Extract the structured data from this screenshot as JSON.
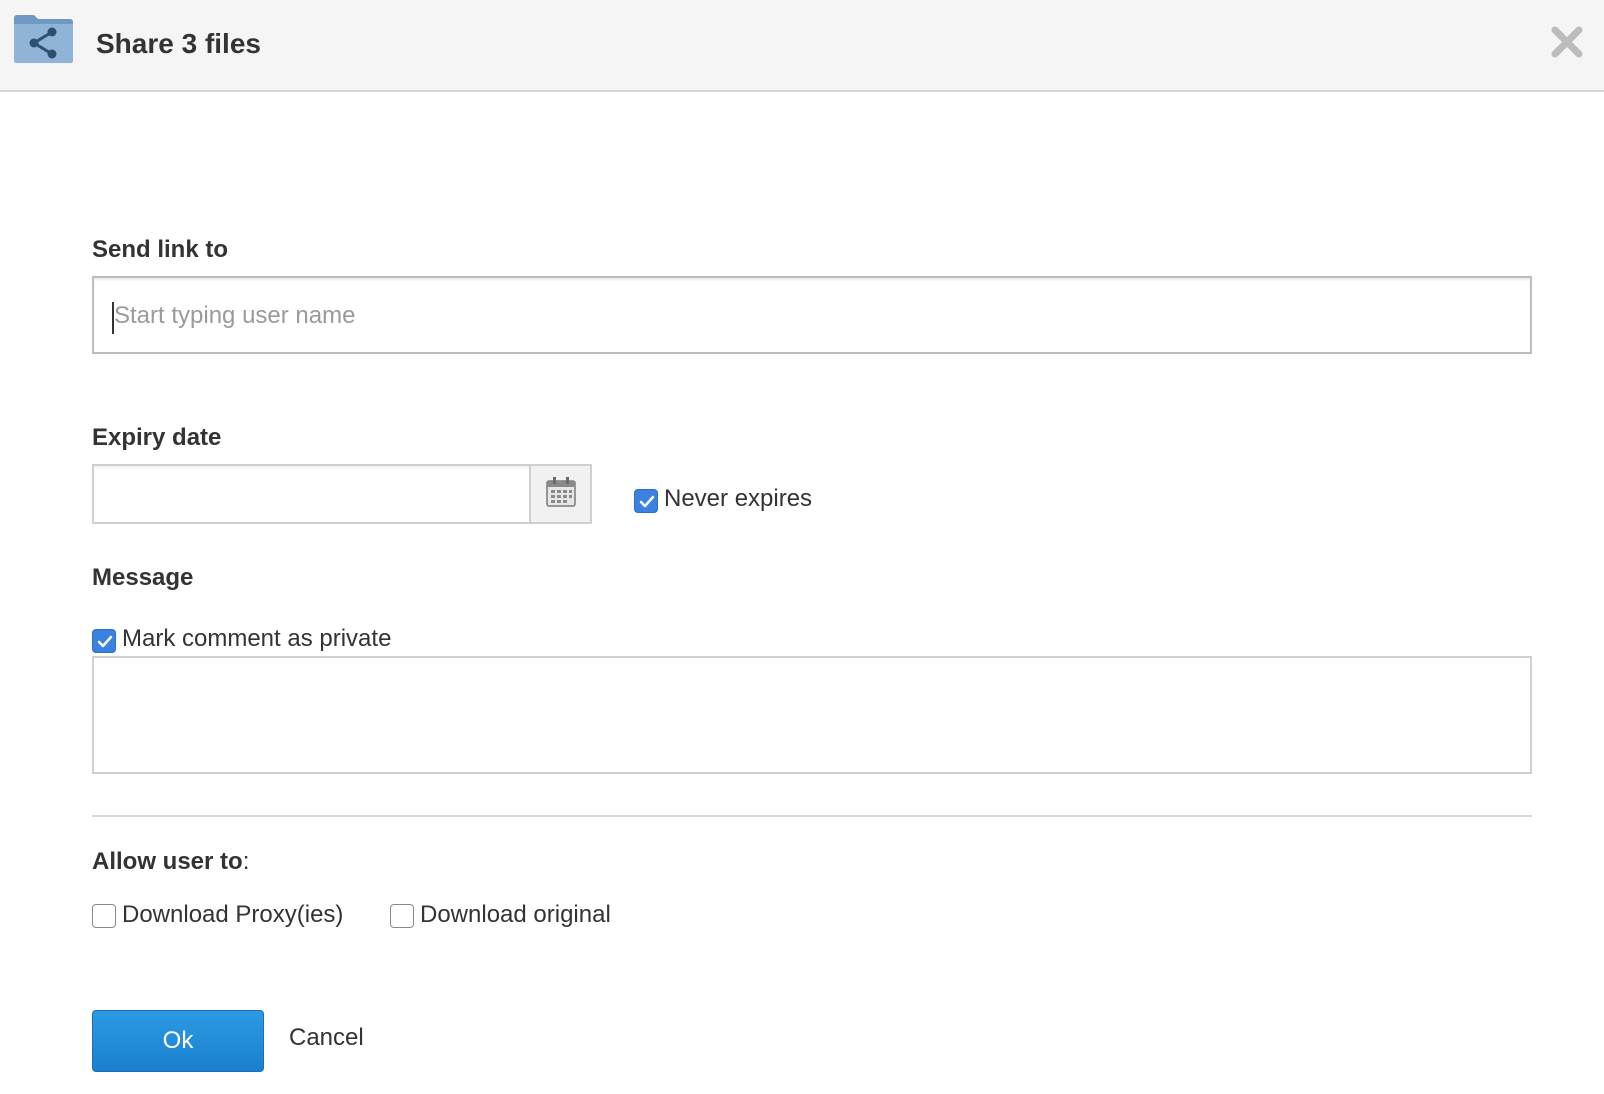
{
  "header": {
    "title": "Share 3 files",
    "icon": "folder-share-icon",
    "close_icon": "close-icon"
  },
  "send_link": {
    "label": "Send link to",
    "placeholder": "Start typing user name",
    "value": ""
  },
  "expiry": {
    "label": "Expiry date",
    "value": "",
    "calendar_icon": "calendar-icon",
    "never_expires_label": "Never expires",
    "never_expires_checked": true
  },
  "message": {
    "label": "Message",
    "private_label": "Mark comment as private",
    "private_checked": true,
    "value": ""
  },
  "permissions": {
    "label": "Allow user to",
    "label_suffix": ":",
    "download_proxies_label": "Download Proxy(ies)",
    "download_proxies_checked": false,
    "download_original_label": "Download original",
    "download_original_checked": false
  },
  "actions": {
    "ok_label": "Ok",
    "cancel_label": "Cancel"
  },
  "colors": {
    "accent": "#1b8ad8",
    "checkbox_checked": "#3b82e0",
    "header_bg": "#f5f5f5"
  }
}
